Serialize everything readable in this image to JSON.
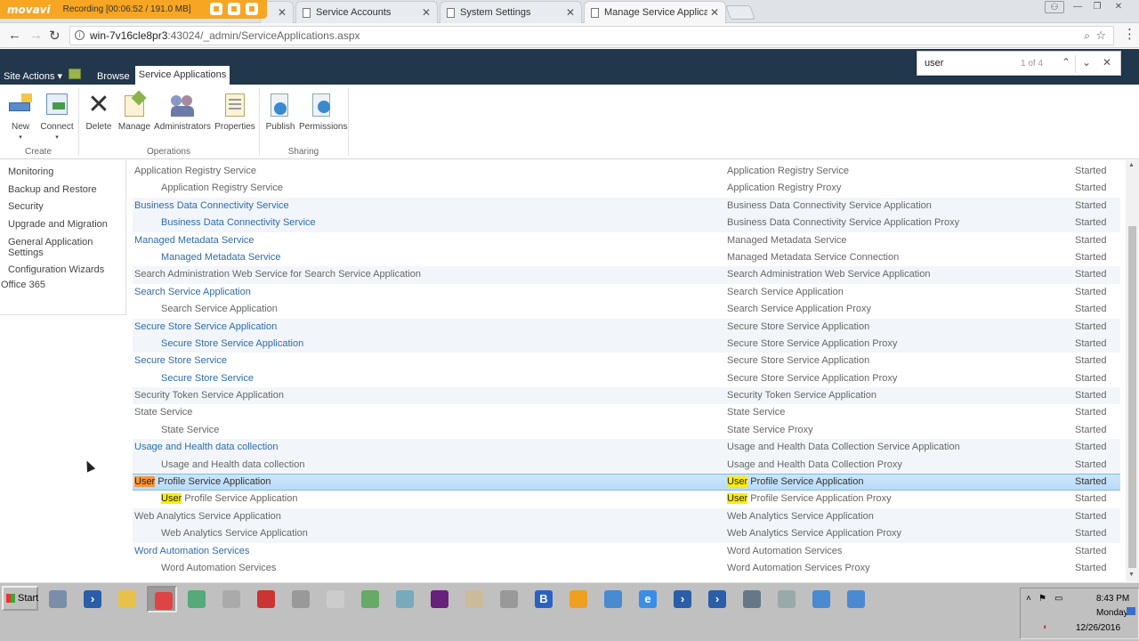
{
  "recorder": {
    "brand": "movavi",
    "status": "Recording  [00:06:52 / 191.0 MB]"
  },
  "tabs": [
    {
      "label": "Service Accounts"
    },
    {
      "label": "System Settings"
    },
    {
      "label": "Manage Service Application"
    }
  ],
  "address": {
    "host": "win-7v16cle8pr3",
    "path": ":43024/_admin/ServiceApplications.aspx"
  },
  "find": {
    "query": "user",
    "count": "1 of 4"
  },
  "ribbon": {
    "site_actions": "Site Actions",
    "browse": "Browse",
    "active_tab": "Service Applications",
    "buttons": {
      "new": "New",
      "connect": "Connect",
      "delete": "Delete",
      "manage": "Manage",
      "administrators": "Administrators",
      "properties": "Properties",
      "publish": "Publish",
      "permissions": "Permissions"
    },
    "groups": {
      "create": "Create",
      "operations": "Operations",
      "sharing": "Sharing"
    }
  },
  "leftnav": {
    "items": [
      "Monitoring",
      "Backup and Restore",
      "Security",
      "Upgrade and Migration",
      "General Application Settings",
      "Configuration Wizards"
    ],
    "office": "Office 365"
  },
  "rows": [
    {
      "name": "Application Registry Service",
      "type": "Application Registry Service",
      "status": "Started",
      "indent": false,
      "link": false
    },
    {
      "name": "Application Registry Service",
      "type": "Application Registry Proxy",
      "status": "Started",
      "indent": true,
      "link": false
    },
    {
      "name": "Business Data Connectivity Service",
      "type": "Business Data Connectivity Service Application",
      "status": "Started",
      "indent": false,
      "link": true
    },
    {
      "name": "Business Data Connectivity Service",
      "type": "Business Data Connectivity Service Application Proxy",
      "status": "Started",
      "indent": true,
      "link": true
    },
    {
      "name": "Managed Metadata Service",
      "type": "Managed Metadata Service",
      "status": "Started",
      "indent": false,
      "link": true
    },
    {
      "name": "Managed Metadata Service",
      "type": "Managed Metadata Service Connection",
      "status": "Started",
      "indent": true,
      "link": true
    },
    {
      "name": "Search Administration Web Service for Search Service Application",
      "type": "Search Administration Web Service Application",
      "status": "Started",
      "indent": false,
      "link": false
    },
    {
      "name": "Search Service Application",
      "type": "Search Service Application",
      "status": "Started",
      "indent": false,
      "link": true
    },
    {
      "name": "Search Service Application",
      "type": "Search Service Application Proxy",
      "status": "Started",
      "indent": true,
      "link": false
    },
    {
      "name": "Secure Store Service Application",
      "type": "Secure Store Service Application",
      "status": "Started",
      "indent": false,
      "link": true
    },
    {
      "name": "Secure Store Service Application",
      "type": "Secure Store Service Application Proxy",
      "status": "Started",
      "indent": true,
      "link": true
    },
    {
      "name": "Secure Store Service",
      "type": "Secure Store Service Application",
      "status": "Started",
      "indent": false,
      "link": true
    },
    {
      "name": "Secure Store Service",
      "type": "Secure Store Service Application Proxy",
      "status": "Started",
      "indent": true,
      "link": true
    },
    {
      "name": "Security Token Service Application",
      "type": "Security Token Service Application",
      "status": "Started",
      "indent": false,
      "link": false
    },
    {
      "name": "State Service",
      "type": "State Service",
      "status": "Started",
      "indent": false,
      "link": false
    },
    {
      "name": "State Service",
      "type": "State Service Proxy",
      "status": "Started",
      "indent": true,
      "link": false
    },
    {
      "name": "Usage and Health data collection",
      "type": "Usage and Health Data Collection Service Application",
      "status": "Started",
      "indent": false,
      "link": true
    },
    {
      "name": "Usage and Health data collection",
      "type": "Usage and Health Data Collection Proxy",
      "status": "Started",
      "indent": true,
      "link": false
    },
    {
      "name": "User Profile Service Application",
      "type": "User Profile Service Application",
      "status": "Started",
      "indent": false,
      "link": false,
      "selected": true,
      "hl": "current"
    },
    {
      "name": "User Profile Service Application",
      "type": "User Profile Service Application Proxy",
      "status": "Started",
      "indent": true,
      "link": false,
      "hl": "match"
    },
    {
      "name": "Web Analytics Service Application",
      "type": "Web Analytics Service Application",
      "status": "Started",
      "indent": false,
      "link": false
    },
    {
      "name": "Web Analytics Service Application",
      "type": "Web Analytics Service Application Proxy",
      "status": "Started",
      "indent": true,
      "link": false
    },
    {
      "name": "Word Automation Services",
      "type": "Word Automation Services",
      "status": "Started",
      "indent": false,
      "link": true
    },
    {
      "name": "Word Automation Services",
      "type": "Word Automation Services Proxy",
      "status": "Started",
      "indent": true,
      "link": false
    }
  ],
  "taskbar": {
    "start": "Start",
    "apps": [
      {
        "icon": "server-manager-icon",
        "color": "#7a8ea8",
        "glyph": ""
      },
      {
        "icon": "powershell-icon",
        "color": "#2a5ea8",
        "glyph": "›"
      },
      {
        "icon": "explorer-icon",
        "color": "#e8c14a",
        "glyph": ""
      },
      {
        "icon": "chrome-icon",
        "color": "#d44",
        "glyph": "",
        "active": true
      },
      {
        "icon": "network-icon",
        "color": "#5a7",
        "glyph": ""
      },
      {
        "icon": "tool-icon",
        "color": "#aaa",
        "glyph": ""
      },
      {
        "icon": "compass-icon",
        "color": "#c33",
        "glyph": ""
      },
      {
        "icon": "satellite-icon",
        "color": "#999",
        "glyph": ""
      },
      {
        "icon": "clock-icon",
        "color": "#ccc",
        "glyph": ""
      },
      {
        "icon": "recycle-icon",
        "color": "#6a6",
        "glyph": ""
      },
      {
        "icon": "disk-icon",
        "color": "#7ab",
        "glyph": ""
      },
      {
        "icon": "visual-studio-icon",
        "color": "#68217a",
        "glyph": ""
      },
      {
        "icon": "package-icon",
        "color": "#cb9",
        "glyph": ""
      },
      {
        "icon": "settings-tools-icon",
        "color": "#999",
        "glyph": ""
      },
      {
        "icon": "b-app-icon",
        "color": "#2a62c4",
        "glyph": "B"
      },
      {
        "icon": "scissors-icon",
        "color": "#f0a020",
        "glyph": ""
      },
      {
        "icon": "network-tools-icon",
        "color": "#4a8ad0",
        "glyph": ""
      },
      {
        "icon": "internet-explorer-icon",
        "color": "#3a8ee6",
        "glyph": "e"
      },
      {
        "icon": "powershell-2-icon",
        "color": "#2a5ea8",
        "glyph": "›"
      },
      {
        "icon": "powershell-3-icon",
        "color": "#2a5ea8",
        "glyph": "›"
      },
      {
        "icon": "gear-icon",
        "color": "#678",
        "glyph": ""
      },
      {
        "icon": "diagram-icon",
        "color": "#9aa",
        "glyph": ""
      },
      {
        "icon": "console-icon",
        "color": "#4a8ad0",
        "glyph": ""
      },
      {
        "icon": "remote-desktop-icon",
        "color": "#4a8ad0",
        "glyph": ""
      }
    ],
    "time": "8:43 PM",
    "day": "Monday",
    "date": "12/26/2016"
  }
}
